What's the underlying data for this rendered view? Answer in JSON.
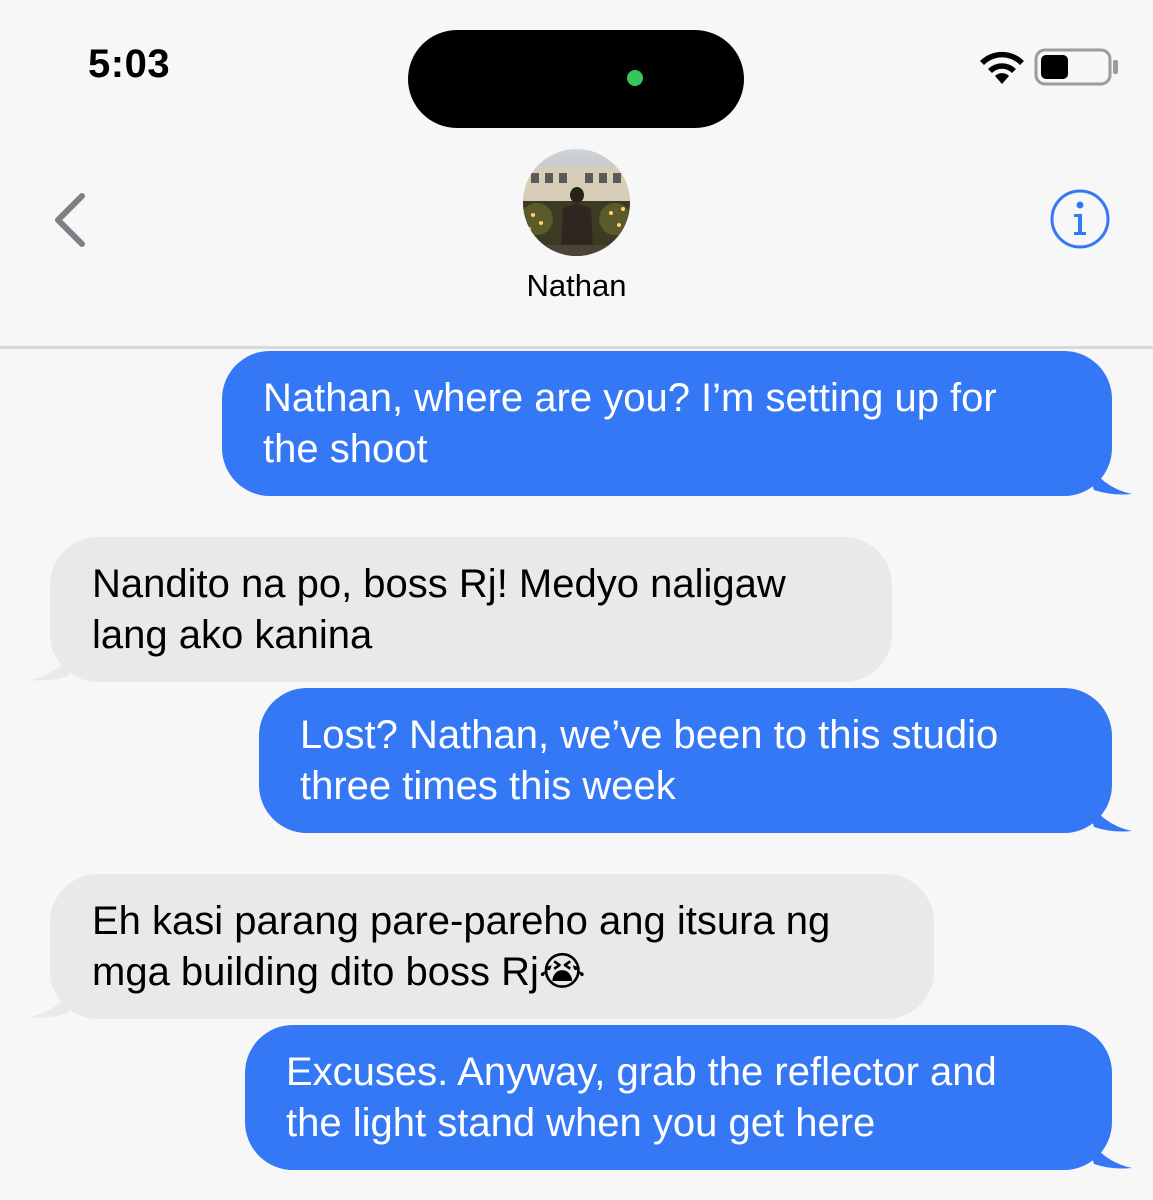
{
  "status_bar": {
    "time": "5:03",
    "icons": [
      "wifi-icon",
      "battery-icon"
    ],
    "camera_indicator_color": "#34c759"
  },
  "header": {
    "contact_name": "Nathan",
    "back_icon": "chevron-left-icon",
    "info_icon": "info-circle-icon",
    "accent_color": "#3478f6"
  },
  "messages": [
    {
      "from": "me",
      "text": "Nathan, where are you? I’m setting up for\nthe shoot"
    },
    {
      "from": "contact",
      "text": "Nandito na po, boss Rj! Medyo naligaw\nlang ako kanina"
    },
    {
      "from": "me",
      "text": "Lost? Nathan, we’ve been to this studio\nthree times this week"
    },
    {
      "from": "contact",
      "text": "Eh kasi parang pare-pareho ang itsura ng\nmga building dito boss Rj😭"
    },
    {
      "from": "me",
      "text": "Excuses. Anyway, grab the reflector and\nthe light stand when you get here"
    }
  ],
  "colors": {
    "sent_bubble": "#3478f6",
    "received_bubble": "#e9e9eb",
    "background": "#f7f7f8"
  }
}
